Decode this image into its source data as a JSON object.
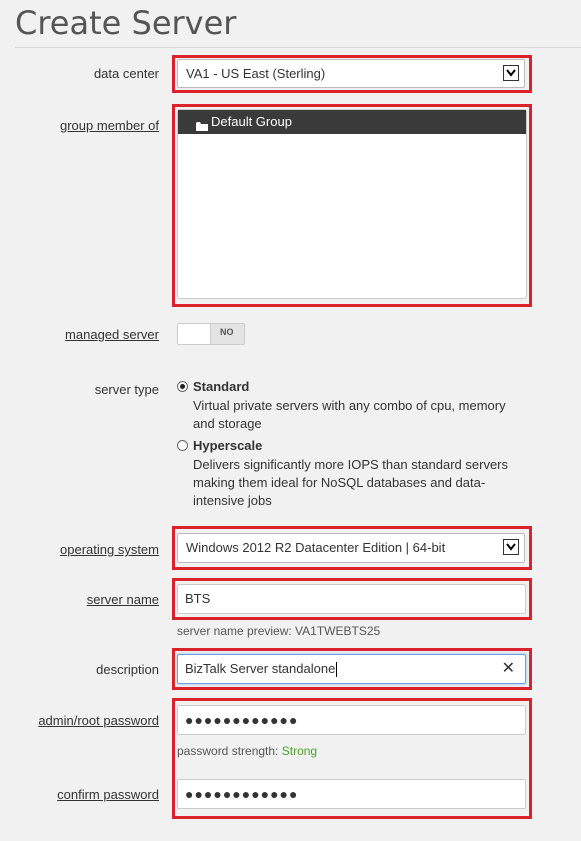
{
  "page": {
    "title": "Create Server"
  },
  "data_center": {
    "label": "data center",
    "value": "VA1 - US East (Sterling)"
  },
  "group": {
    "label": "group member of",
    "selected": "Default Group"
  },
  "managed": {
    "label": "managed server",
    "toggle_text": "NO",
    "enabled": false
  },
  "server_type": {
    "label": "server type",
    "options": [
      {
        "title": "Standard",
        "selected": true,
        "desc": "Virtual private servers with any combo of cpu, memory and storage"
      },
      {
        "title": "Hyperscale",
        "selected": false,
        "desc": "Delivers significantly more IOPS than standard servers making them ideal for NoSQL databases and data-intensive jobs"
      }
    ]
  },
  "os": {
    "label": "operating system",
    "value": "Windows 2012 R2 Datacenter Edition | 64-bit"
  },
  "server_name": {
    "label": "server name",
    "value": "BTS",
    "preview": "server name preview: VA1TWEBTS25"
  },
  "description": {
    "label": "description",
    "value": "BizTalk Server standalone",
    "clear_symbol": "✕"
  },
  "password": {
    "label": "admin/root password",
    "masked": "●●●●●●●●●●●●",
    "strength_label": "password strength:",
    "strength_value": "Strong",
    "strength_color": "#4a9e2e"
  },
  "confirm": {
    "label": "confirm password",
    "masked": "●●●●●●●●●●●●"
  },
  "highlight_color": "#d9222a"
}
